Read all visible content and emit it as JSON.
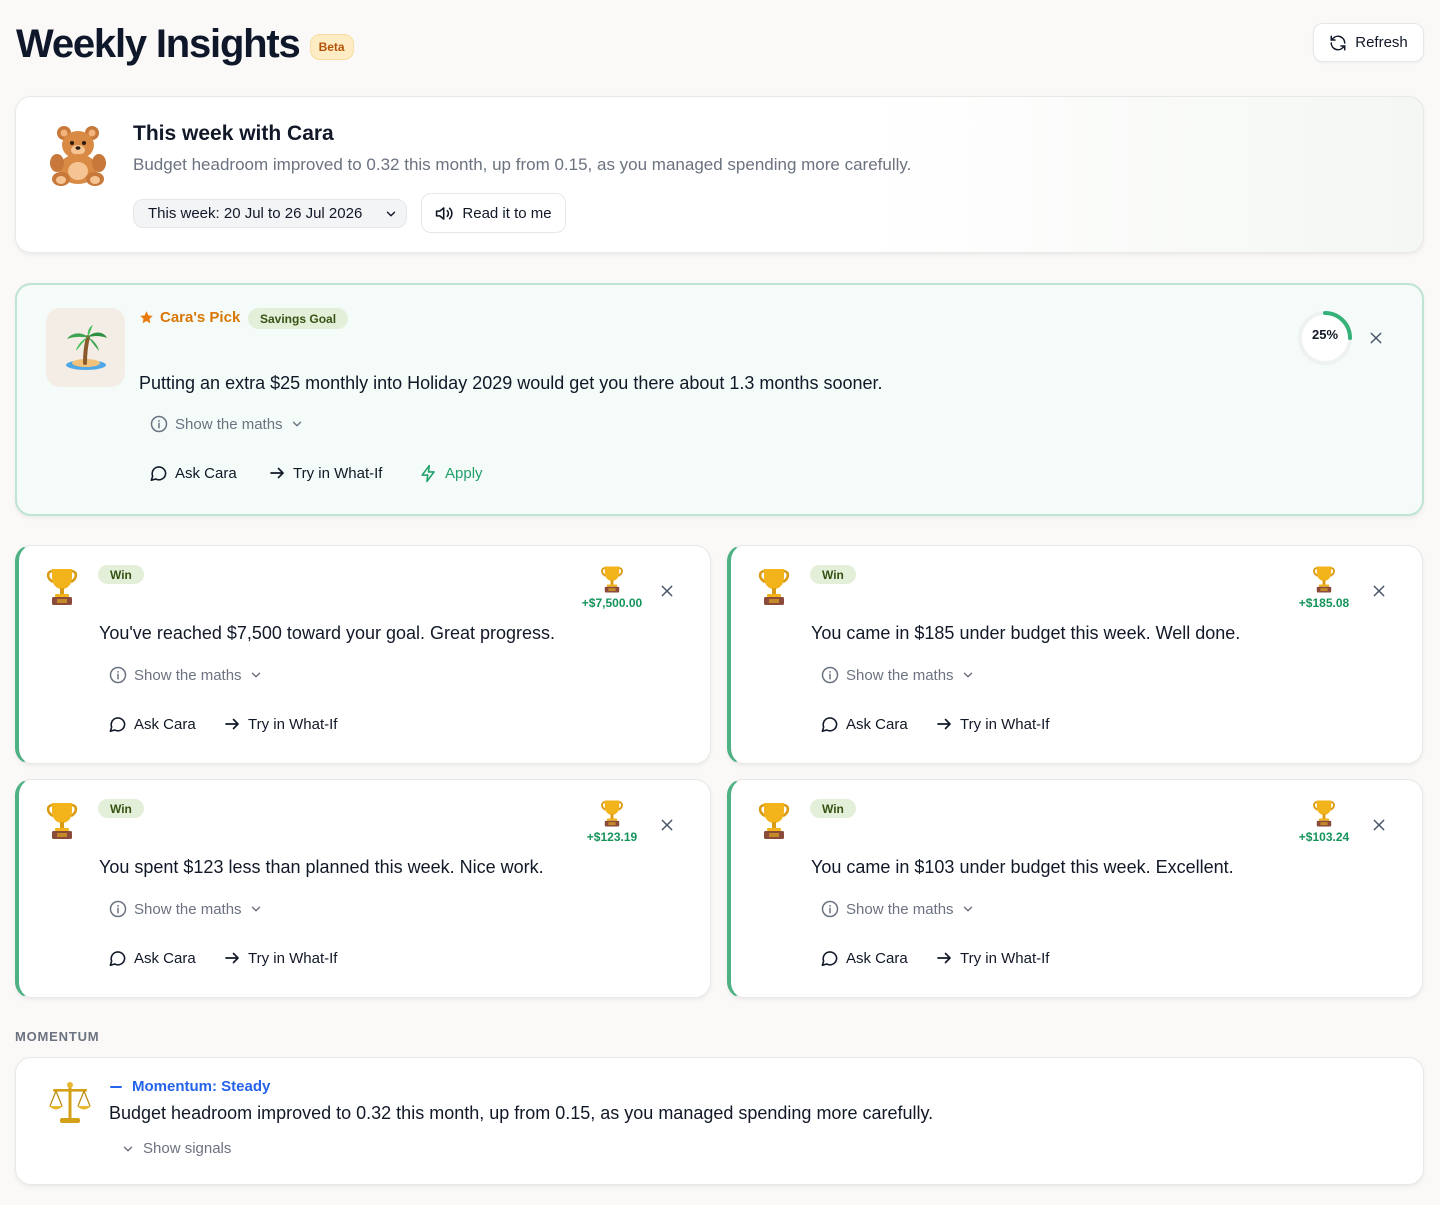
{
  "header": {
    "title": "Weekly Insights",
    "beta_badge": "Beta",
    "refresh_label": "Refresh"
  },
  "intro": {
    "title": "This week with Cara",
    "summary": "Budget headroom improved to 0.32 this month, up from 0.15, as you managed spending more carefully.",
    "week_select_value": "This week: 20 Jul to 26 Jul 2026",
    "read_button_label": "Read it to me"
  },
  "pick": {
    "label": "Cara's Pick",
    "category_badge": "Savings Goal",
    "text": "Putting an extra $25 monthly into Holiday 2029 would get you there about 1.3 months sooner.",
    "progress": 0.25,
    "progress_label": "25%",
    "show_maths_label": "Show the maths",
    "ask_label": "Ask Cara",
    "whatif_label": "Try in What-If",
    "apply_label": "Apply",
    "icon": "palm-island-icon"
  },
  "wins": [
    {
      "badge": "Win",
      "amount": "+$7,500.00",
      "text": "You've reached $7,500 toward your goal. Great progress.",
      "show_maths_label": "Show the maths",
      "ask_label": "Ask Cara",
      "whatif_label": "Try in What-If"
    },
    {
      "badge": "Win",
      "amount": "+$185.08",
      "text": "You came in $185 under budget this week. Well done.",
      "show_maths_label": "Show the maths",
      "ask_label": "Ask Cara",
      "whatif_label": "Try in What-If"
    },
    {
      "badge": "Win",
      "amount": "+$123.19",
      "text": "You spent $123 less than planned this week. Nice work.",
      "show_maths_label": "Show the maths",
      "ask_label": "Ask Cara",
      "whatif_label": "Try in What-If"
    },
    {
      "badge": "Win",
      "amount": "+$103.24",
      "text": "You came in $103 under budget this week. Excellent.",
      "show_maths_label": "Show the maths",
      "ask_label": "Ask Cara",
      "whatif_label": "Try in What-If"
    }
  ],
  "momentum": {
    "section_heading": "MOMENTUM",
    "label": "Momentum: Steady",
    "text": "Budget headroom improved to 0.32 this month, up from 0.15, as you managed spending more carefully.",
    "signals_label": "Show signals"
  },
  "colors": {
    "accent_green": "#22a06b",
    "win_border": "#4fb184",
    "pick_orange": "#d97706",
    "momentum_blue": "#2563eb"
  }
}
